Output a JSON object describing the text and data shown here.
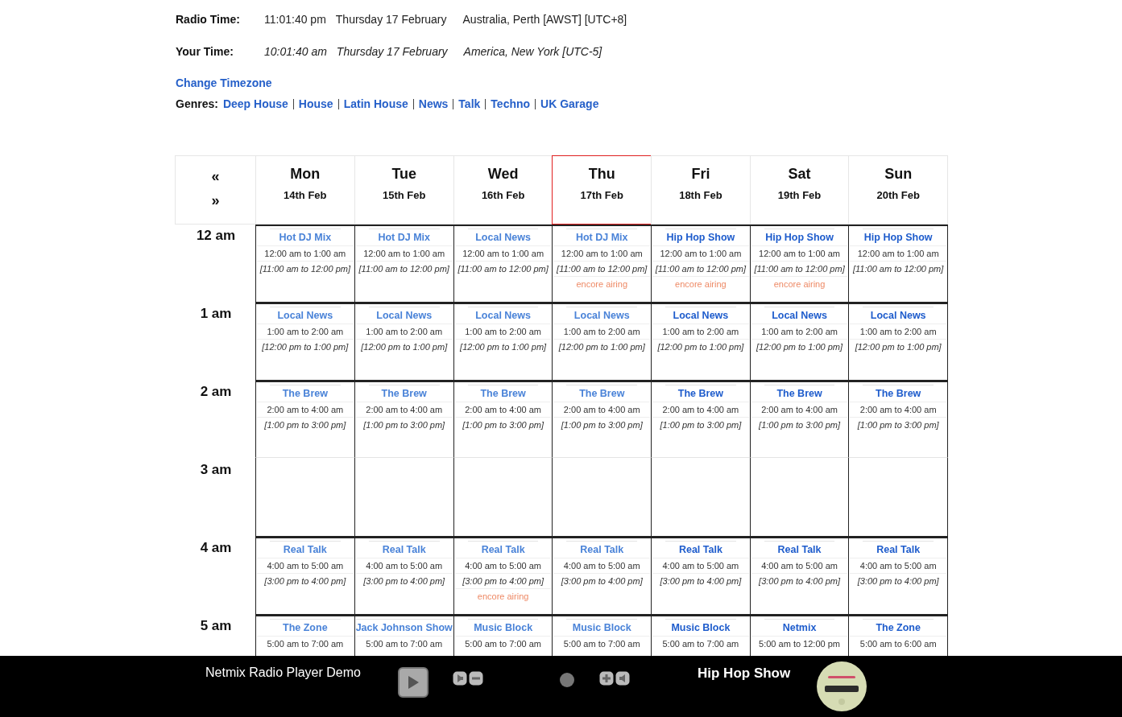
{
  "clock": [
    {
      "label": "Radio Time:",
      "kind": "radio",
      "time": "11:01:40 pm",
      "date": "Thursday 17 February",
      "zone": "Australia, Perth [AWST] [UTC+8]"
    },
    {
      "label": "Your Time:",
      "kind": "local",
      "time": "10:01:40 am",
      "date": "Thursday 17 February",
      "zone": "America, New York [UTC-5]"
    }
  ],
  "change_timezone": "Change Timezone",
  "genres": {
    "label": "Genres:",
    "items": [
      "Deep House",
      "House",
      "Latin House",
      "News",
      "Talk",
      "Techno",
      "UK Garage"
    ]
  },
  "schedule": {
    "nav": {
      "previous": "«",
      "next": "»"
    },
    "days": [
      {
        "name": "Mon",
        "date": "14th Feb",
        "today": false,
        "past": true
      },
      {
        "name": "Tue",
        "date": "15th Feb",
        "today": false,
        "past": true
      },
      {
        "name": "Wed",
        "date": "16th Feb",
        "today": false,
        "past": true
      },
      {
        "name": "Thu",
        "date": "17th Feb",
        "today": true,
        "past": true
      },
      {
        "name": "Fri",
        "date": "18th Feb",
        "today": false,
        "past": false
      },
      {
        "name": "Sat",
        "date": "19th Feb",
        "today": false,
        "past": false
      },
      {
        "name": "Sun",
        "date": "20th Feb",
        "today": false,
        "past": false
      }
    ],
    "rows": [
      {
        "hour": "12 am",
        "cells": [
          {
            "title": "Hot DJ Mix",
            "time": "12:00 am to 1:00 am",
            "your_time": "[11:00 am to 12:00 pm]"
          },
          {
            "title": "Hot DJ Mix",
            "time": "12:00 am to 1:00 am",
            "your_time": "[11:00 am to 12:00 pm]"
          },
          {
            "title": "Local News",
            "time": "12:00 am to 1:00 am",
            "your_time": "[11:00 am to 12:00 pm]"
          },
          {
            "title": "Hot DJ Mix",
            "time": "12:00 am to 1:00 am",
            "your_time": "[11:00 am to 12:00 pm]",
            "note": "encore airing"
          },
          {
            "title": "Hip Hop Show",
            "time": "12:00 am to 1:00 am",
            "your_time": "[11:00 am to 12:00 pm]",
            "note": "encore airing"
          },
          {
            "title": "Hip Hop Show",
            "time": "12:00 am to 1:00 am",
            "your_time": "[11:00 am to 12:00 pm]",
            "note": "encore airing"
          },
          {
            "title": "Hip Hop Show",
            "time": "12:00 am to 1:00 am",
            "your_time": "[11:00 am to 12:00 pm]"
          }
        ]
      },
      {
        "hour": "1 am",
        "cells": [
          {
            "title": "Local News",
            "time": "1:00 am to 2:00 am",
            "your_time": "[12:00 pm to 1:00 pm]"
          },
          {
            "title": "Local News",
            "time": "1:00 am to 2:00 am",
            "your_time": "[12:00 pm to 1:00 pm]"
          },
          {
            "title": "Local News",
            "time": "1:00 am to 2:00 am",
            "your_time": "[12:00 pm to 1:00 pm]"
          },
          {
            "title": "Local News",
            "time": "1:00 am to 2:00 am",
            "your_time": "[12:00 pm to 1:00 pm]"
          },
          {
            "title": "Local News",
            "time": "1:00 am to 2:00 am",
            "your_time": "[12:00 pm to 1:00 pm]"
          },
          {
            "title": "Local News",
            "time": "1:00 am to 2:00 am",
            "your_time": "[12:00 pm to 1:00 pm]"
          },
          {
            "title": "Local News",
            "time": "1:00 am to 2:00 am",
            "your_time": "[12:00 pm to 1:00 pm]"
          }
        ]
      },
      {
        "hour": "2 am",
        "cells": [
          {
            "title": "The Brew",
            "time": "2:00 am to 4:00 am",
            "your_time": "[1:00 pm to 3:00 pm]"
          },
          {
            "title": "The Brew",
            "time": "2:00 am to 4:00 am",
            "your_time": "[1:00 pm to 3:00 pm]"
          },
          {
            "title": "The Brew",
            "time": "2:00 am to 4:00 am",
            "your_time": "[1:00 pm to 3:00 pm]"
          },
          {
            "title": "The Brew",
            "time": "2:00 am to 4:00 am",
            "your_time": "[1:00 pm to 3:00 pm]"
          },
          {
            "title": "The Brew",
            "time": "2:00 am to 4:00 am",
            "your_time": "[1:00 pm to 3:00 pm]"
          },
          {
            "title": "The Brew",
            "time": "2:00 am to 4:00 am",
            "your_time": "[1:00 pm to 3:00 pm]"
          },
          {
            "title": "The Brew",
            "time": "2:00 am to 4:00 am",
            "your_time": "[1:00 pm to 3:00 pm]"
          }
        ]
      },
      {
        "hour": "3 am",
        "continued": true
      },
      {
        "hour": "4 am",
        "cells": [
          {
            "title": "Real Talk",
            "time": "4:00 am to 5:00 am",
            "your_time": "[3:00 pm to 4:00 pm]"
          },
          {
            "title": "Real Talk",
            "time": "4:00 am to 5:00 am",
            "your_time": "[3:00 pm to 4:00 pm]"
          },
          {
            "title": "Real Talk",
            "time": "4:00 am to 5:00 am",
            "your_time": "[3:00 pm to 4:00 pm]",
            "note": "encore airing"
          },
          {
            "title": "Real Talk",
            "time": "4:00 am to 5:00 am",
            "your_time": "[3:00 pm to 4:00 pm]"
          },
          {
            "title": "Real Talk",
            "time": "4:00 am to 5:00 am",
            "your_time": "[3:00 pm to 4:00 pm]"
          },
          {
            "title": "Real Talk",
            "time": "4:00 am to 5:00 am",
            "your_time": "[3:00 pm to 4:00 pm]"
          },
          {
            "title": "Real Talk",
            "time": "4:00 am to 5:00 am",
            "your_time": "[3:00 pm to 4:00 pm]"
          }
        ]
      },
      {
        "hour": "5 am",
        "cells": [
          {
            "title": "The Zone",
            "time": "5:00 am to 7:00 am"
          },
          {
            "title": "Jack Johnson Show",
            "time": "5:00 am to 7:00 am"
          },
          {
            "title": "Music Block",
            "time": "5:00 am to 7:00 am"
          },
          {
            "title": "Music Block",
            "time": "5:00 am to 7:00 am"
          },
          {
            "title": "Music Block",
            "time": "5:00 am to 7:00 am"
          },
          {
            "title": "Netmix",
            "time": "5:00 am to 12:00 pm"
          },
          {
            "title": "The Zone",
            "time": "5:00 am to 6:00 am"
          }
        ]
      }
    ]
  },
  "player": {
    "title": "Netmix Radio Player Demo",
    "playing": false,
    "volume": {
      "level": 0.75
    },
    "now_playing": "Hip Hop Show"
  }
}
